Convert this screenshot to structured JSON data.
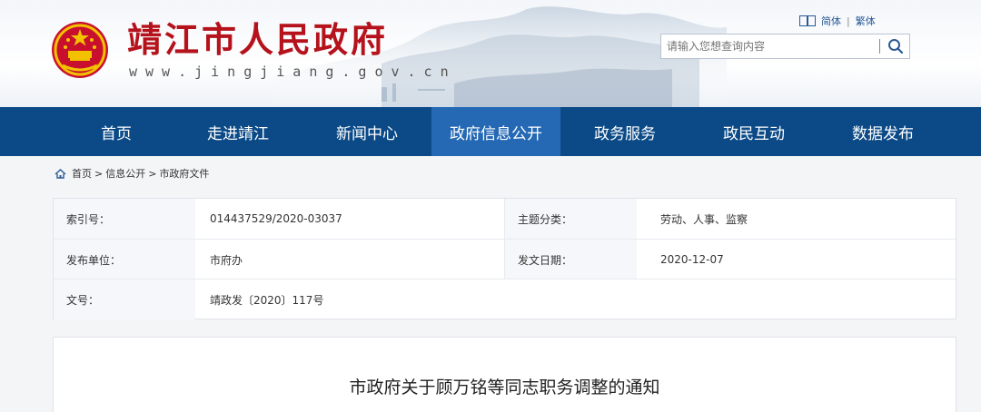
{
  "header": {
    "site_title": "靖江市人民政府",
    "site_url": "www.jingjiang.gov.cn",
    "lang": {
      "simplified": "简体",
      "separator": "|",
      "traditional": "繁体"
    },
    "search": {
      "placeholder": "请输入您想查询内容",
      "icon": "search-icon"
    },
    "colors": {
      "title": "#b5121b",
      "nav": "#0b4a87",
      "nav_active": "#2569b5"
    }
  },
  "nav": {
    "items": [
      {
        "label": "首页"
      },
      {
        "label": "走进靖江"
      },
      {
        "label": "新闻中心"
      },
      {
        "label": "政府信息公开",
        "active": true
      },
      {
        "label": "政务服务"
      },
      {
        "label": "政民互动"
      },
      {
        "label": "数据发布"
      }
    ]
  },
  "breadcrumb": {
    "icon": "home-icon",
    "items": [
      "首页",
      "信息公开",
      "市政府文件"
    ],
    "separator": ">"
  },
  "meta": {
    "index_label": "索引号：",
    "index_value": "014437529/2020-03037",
    "topic_label": "主题分类：",
    "topic_value": "劳动、人事、监察",
    "publisher_label": "发布单位：",
    "publisher_value": "市府办",
    "date_label": "发文日期：",
    "date_value": "2020-12-07",
    "docno_label": "文号：",
    "docno_value": "靖政发〔2020〕117号"
  },
  "article": {
    "title": "市政府关于顾万铭等同志职务调整的通知"
  }
}
